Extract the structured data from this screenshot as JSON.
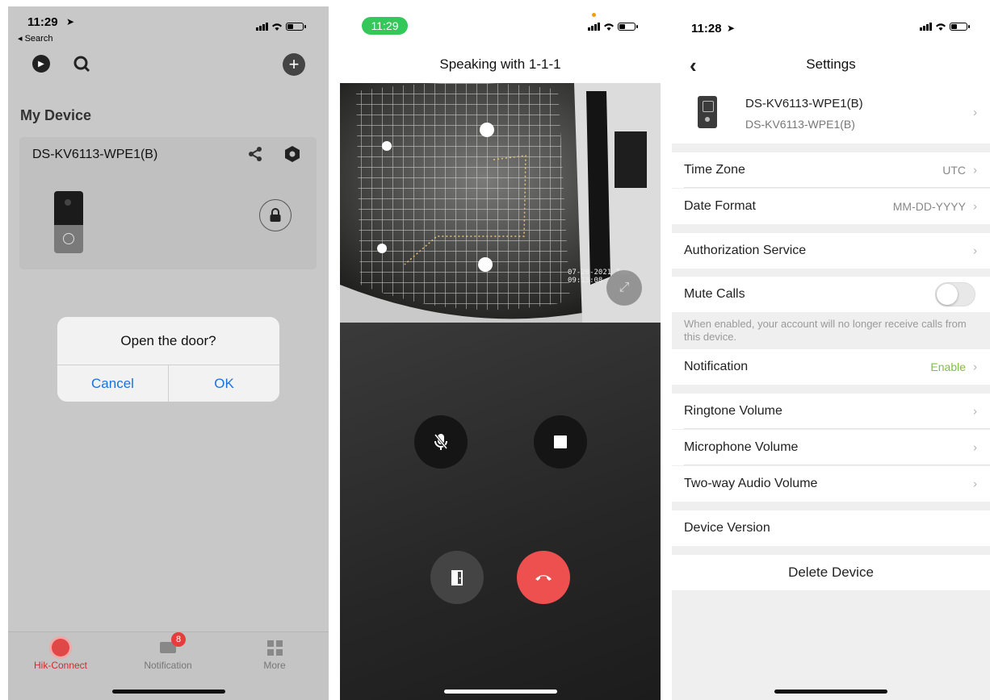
{
  "screen1": {
    "status": {
      "time": "11:29",
      "back_label": "◂ Search"
    },
    "title": "My Device",
    "device": {
      "name": "DS-KV6113-WPE1(B)"
    },
    "dialog": {
      "title": "Open the door?",
      "cancel": "Cancel",
      "ok": "OK"
    },
    "tabs": [
      {
        "label": "Hik-Connect"
      },
      {
        "label": "Notification",
        "badge": "8"
      },
      {
        "label": "More"
      }
    ],
    "colors": {
      "accent": "#d12b2b",
      "link": "#1a73d9"
    }
  },
  "screen2": {
    "status": {
      "time": "11:29"
    },
    "title": "Speaking with 1-1-1",
    "video_timestamp": "07-20-2021 Tue 09:13:08"
  },
  "screen3": {
    "status": {
      "time": "11:28"
    },
    "title": "Settings",
    "device": {
      "name": "DS-KV6113-WPE1(B)",
      "model": "DS-KV6113-WPE1(B)"
    },
    "time_zone": {
      "label": "Time Zone",
      "value": "UTC"
    },
    "date_format": {
      "label": "Date Format",
      "value": "MM-DD-YYYY"
    },
    "authorization": {
      "label": "Authorization Service"
    },
    "mute_calls": {
      "label": "Mute Calls",
      "enabled": false,
      "note": "When enabled, your account will no longer receive calls from this device."
    },
    "notification": {
      "label": "Notification",
      "value": "Enable"
    },
    "ringtone": {
      "label": "Ringtone Volume"
    },
    "microphone": {
      "label": "Microphone Volume"
    },
    "two_way": {
      "label": "Two-way Audio Volume"
    },
    "version": {
      "label": "Device Version"
    },
    "delete": {
      "label": "Delete Device"
    },
    "colors": {
      "enable": "#7fbf3f"
    }
  }
}
